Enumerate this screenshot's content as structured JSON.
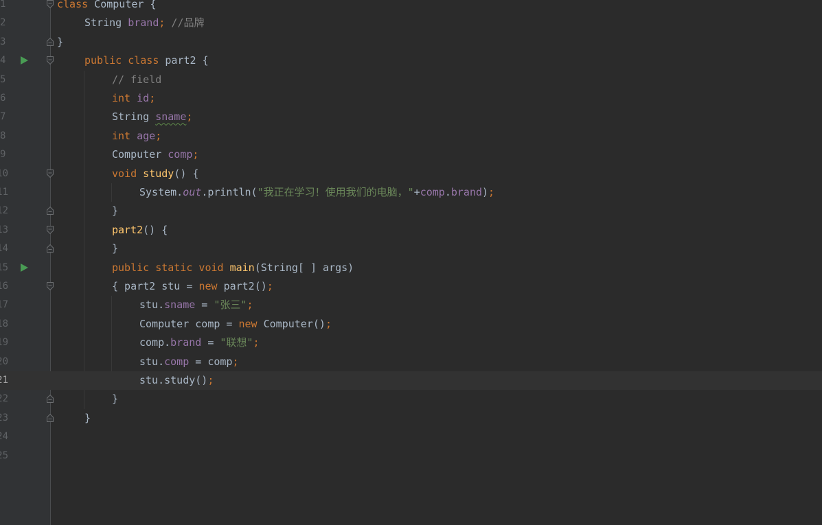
{
  "editor": {
    "lines": [
      {
        "num": "1",
        "indent": 0,
        "run": false,
        "fold": "start",
        "tokens": [
          {
            "t": "class",
            "c": "kw"
          },
          {
            "t": " Computer {"
          }
        ]
      },
      {
        "num": "2",
        "indent": 1,
        "run": false,
        "fold": null,
        "tokens": [
          {
            "t": "String "
          },
          {
            "t": "brand",
            "c": "fld"
          },
          {
            "t": ";",
            "c": "kw"
          },
          {
            "t": " //品牌",
            "c": "cmt"
          }
        ]
      },
      {
        "num": "3",
        "indent": 0,
        "run": false,
        "fold": "end",
        "tokens": [
          {
            "t": "}"
          }
        ]
      },
      {
        "num": "4",
        "indent": 1,
        "run": true,
        "fold": "start",
        "tokens": [
          {
            "t": "public class ",
            "c": "kw"
          },
          {
            "t": "part2 {"
          }
        ]
      },
      {
        "num": "5",
        "indent": 2,
        "run": false,
        "fold": null,
        "tokens": [
          {
            "t": "// field",
            "c": "cmt"
          }
        ]
      },
      {
        "num": "6",
        "indent": 2,
        "run": false,
        "fold": null,
        "tokens": [
          {
            "t": "int ",
            "c": "kw"
          },
          {
            "t": "id",
            "c": "fld"
          },
          {
            "t": ";",
            "c": "kw"
          }
        ]
      },
      {
        "num": "7",
        "indent": 2,
        "run": false,
        "fold": null,
        "tokens": [
          {
            "t": "String "
          },
          {
            "t": "sname",
            "c": "fld typo"
          },
          {
            "t": ";",
            "c": "kw"
          }
        ]
      },
      {
        "num": "8",
        "indent": 2,
        "run": false,
        "fold": null,
        "tokens": [
          {
            "t": "int ",
            "c": "kw"
          },
          {
            "t": "age",
            "c": "fld"
          },
          {
            "t": ";",
            "c": "kw"
          }
        ]
      },
      {
        "num": "9",
        "indent": 2,
        "run": false,
        "fold": null,
        "tokens": [
          {
            "t": "Computer "
          },
          {
            "t": "comp",
            "c": "fld"
          },
          {
            "t": ";",
            "c": "kw"
          }
        ]
      },
      {
        "num": "10",
        "indent": 2,
        "run": false,
        "fold": "start",
        "tokens": [
          {
            "t": "void ",
            "c": "kw"
          },
          {
            "t": "study",
            "c": "fn"
          },
          {
            "t": "() {"
          }
        ]
      },
      {
        "num": "11",
        "indent": 3,
        "run": false,
        "fold": null,
        "tokens": [
          {
            "t": "System."
          },
          {
            "t": "out",
            "c": "italic-static"
          },
          {
            "t": ".println("
          },
          {
            "t": "\"我正在学习！使用我们的电脑，\"",
            "c": "str"
          },
          {
            "t": "+"
          },
          {
            "t": "comp",
            "c": "fld"
          },
          {
            "t": "."
          },
          {
            "t": "brand",
            "c": "fld"
          },
          {
            "t": ")"
          },
          {
            "t": ";",
            "c": "kw"
          }
        ]
      },
      {
        "num": "12",
        "indent": 2,
        "run": false,
        "fold": "end",
        "tokens": [
          {
            "t": "}"
          }
        ]
      },
      {
        "num": "13",
        "indent": 2,
        "run": false,
        "fold": "start",
        "tokens": [
          {
            "t": "part2",
            "c": "fn"
          },
          {
            "t": "() {"
          }
        ]
      },
      {
        "num": "14",
        "indent": 2,
        "run": false,
        "fold": "end",
        "tokens": [
          {
            "t": "}"
          }
        ]
      },
      {
        "num": "15",
        "indent": 2,
        "run": true,
        "fold": null,
        "tokens": [
          {
            "t": "public static void ",
            "c": "kw"
          },
          {
            "t": "main",
            "c": "fn"
          },
          {
            "t": "(String[ ] args)"
          }
        ]
      },
      {
        "num": "16",
        "indent": 2,
        "run": false,
        "fold": "start",
        "tokens": [
          {
            "t": "{ part2 stu = "
          },
          {
            "t": "new ",
            "c": "kw"
          },
          {
            "t": "part2()"
          },
          {
            "t": ";",
            "c": "kw"
          }
        ]
      },
      {
        "num": "17",
        "indent": 3,
        "run": false,
        "fold": null,
        "tokens": [
          {
            "t": "stu."
          },
          {
            "t": "sname",
            "c": "fld"
          },
          {
            "t": " = "
          },
          {
            "t": "\"张三\"",
            "c": "str"
          },
          {
            "t": ";",
            "c": "kw"
          }
        ]
      },
      {
        "num": "18",
        "indent": 3,
        "run": false,
        "fold": null,
        "tokens": [
          {
            "t": "Computer comp = "
          },
          {
            "t": "new ",
            "c": "kw"
          },
          {
            "t": "Computer()"
          },
          {
            "t": ";",
            "c": "kw"
          }
        ]
      },
      {
        "num": "19",
        "indent": 3,
        "run": false,
        "fold": null,
        "tokens": [
          {
            "t": "comp."
          },
          {
            "t": "brand",
            "c": "fld"
          },
          {
            "t": " = "
          },
          {
            "t": "\"联想\"",
            "c": "str"
          },
          {
            "t": ";",
            "c": "kw"
          }
        ]
      },
      {
        "num": "20",
        "indent": 3,
        "run": false,
        "fold": null,
        "tokens": [
          {
            "t": "stu."
          },
          {
            "t": "comp",
            "c": "fld"
          },
          {
            "t": " = comp"
          },
          {
            "t": ";",
            "c": "kw"
          }
        ]
      },
      {
        "num": "21",
        "indent": 3,
        "run": false,
        "fold": null,
        "current": true,
        "tokens": [
          {
            "t": "stu.study()"
          },
          {
            "t": ";",
            "c": "kw"
          }
        ]
      },
      {
        "num": "22",
        "indent": 2,
        "run": false,
        "fold": "end",
        "tokens": [
          {
            "t": "}"
          }
        ]
      },
      {
        "num": "23",
        "indent": 1,
        "run": false,
        "fold": "end",
        "tokens": [
          {
            "t": "}"
          }
        ]
      },
      {
        "num": "24",
        "indent": 0,
        "run": false,
        "fold": null,
        "tokens": []
      },
      {
        "num": "25",
        "indent": 0,
        "run": false,
        "fold": null,
        "tokens": []
      }
    ]
  },
  "colors": {
    "background": "#2b2b2b",
    "gutter": "#313335",
    "keyword": "#cc7832",
    "field": "#9876aa",
    "string": "#6a8759",
    "comment": "#808080",
    "function": "#ffc66d",
    "text": "#a9b7c6",
    "run_icon": "#499c54"
  }
}
